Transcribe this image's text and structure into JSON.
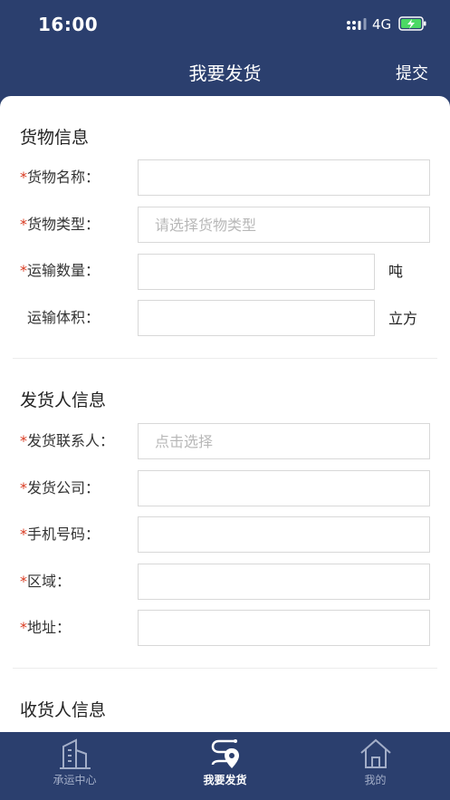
{
  "status_bar": {
    "time": "16:00",
    "network": "4G",
    "signal_icon": "signal-dots-icon",
    "battery_icon": "battery-charging-icon"
  },
  "nav": {
    "title": "我要发货",
    "submit_label": "提交"
  },
  "colors": {
    "primary": "#2b3f6e",
    "required": "#d9381e",
    "battery": "#4cd964"
  },
  "cargo": {
    "title": "货物信息",
    "fields": [
      {
        "required": true,
        "label": "货物名称：",
        "value": "",
        "placeholder": ""
      },
      {
        "required": true,
        "label": "货物类型：",
        "value": "",
        "placeholder": "请选择货物类型"
      },
      {
        "required": true,
        "label": "运输数量：",
        "value": "",
        "placeholder": "",
        "unit": "吨"
      },
      {
        "required": false,
        "label": "运输体积：",
        "value": "",
        "placeholder": "",
        "unit": "立方"
      }
    ]
  },
  "shipper": {
    "title": "发货人信息",
    "fields": [
      {
        "required": true,
        "label": "发货联系人：",
        "value": "",
        "placeholder": "点击选择"
      },
      {
        "required": true,
        "label": "发货公司：",
        "value": "",
        "placeholder": ""
      },
      {
        "required": true,
        "label": "手机号码：",
        "value": "",
        "placeholder": ""
      },
      {
        "required": true,
        "label": "区域：",
        "value": "",
        "placeholder": ""
      },
      {
        "required": true,
        "label": "地址：",
        "value": "",
        "placeholder": ""
      }
    ]
  },
  "receiver": {
    "title": "收货人信息"
  },
  "required_mark": "*",
  "tabs": [
    {
      "label": "承运中心",
      "icon": "building-icon",
      "active": false
    },
    {
      "label": "我要发货",
      "icon": "route-pin-icon",
      "active": true
    },
    {
      "label": "我的",
      "icon": "home-icon",
      "active": false
    }
  ]
}
